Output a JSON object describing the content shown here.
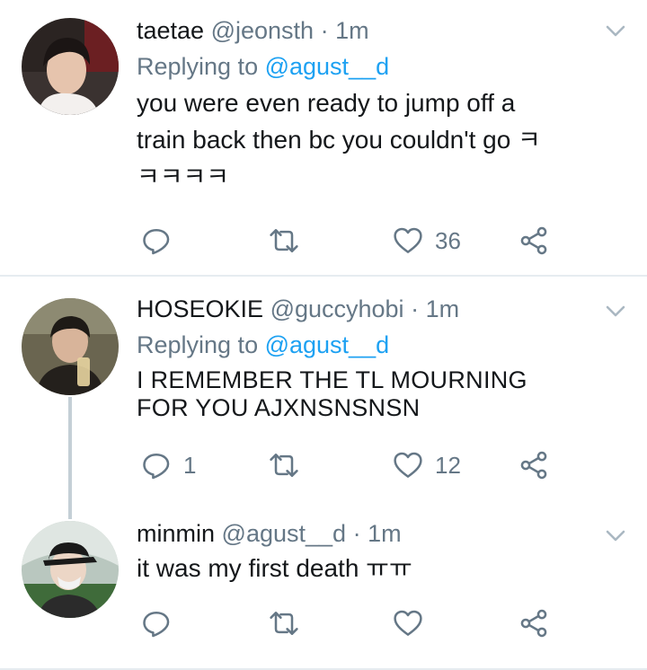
{
  "tweets": [
    {
      "name": "taetae",
      "handle": "@jeonsth",
      "separator": "·",
      "time": "1m",
      "replying_prefix": "Replying to ",
      "replying_to": "@agust__d",
      "text_line1": "you were even ready to jump off a",
      "text_line2": "train back then bc you couldn't go ㅋ",
      "text_line3": "ㅋㅋㅋㅋ",
      "reply_count": "",
      "retweet_count": "",
      "like_count": "36"
    },
    {
      "name": "HOSEOKIE",
      "handle": "@guccyhobi",
      "separator": "·",
      "time": "1m",
      "replying_prefix": "Replying to ",
      "replying_to": "@agust__d",
      "text_line1": "I REMEMBER THE TL MOURNING",
      "text_line2": "FOR YOU AJXNSNSNSN",
      "reply_count": "1",
      "retweet_count": "",
      "like_count": "12"
    },
    {
      "name": "minmin",
      "handle": "@agust__d",
      "separator": "·",
      "time": "1m",
      "text_line1": "it was my first death ㅠㅠ",
      "reply_count": "",
      "retweet_count": "",
      "like_count": ""
    }
  ],
  "colors": {
    "text": "#14171a",
    "secondary": "#657786",
    "mention": "#1da1f2",
    "thread_line": "#c4cfd6",
    "divider": "#e6ecf0"
  },
  "icons": [
    "reply-icon",
    "retweet-icon",
    "like-icon",
    "share-icon",
    "chevron-down-icon"
  ]
}
